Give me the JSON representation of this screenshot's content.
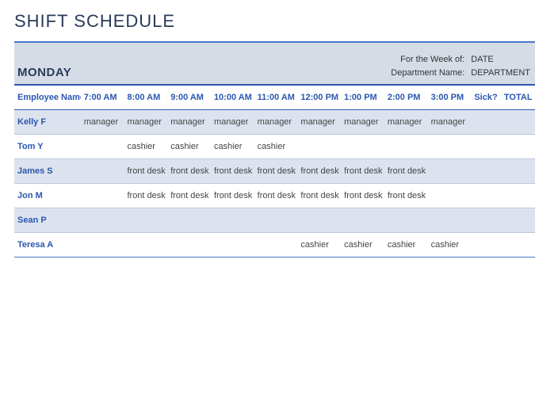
{
  "title": "SHIFT SCHEDULE",
  "day": "MONDAY",
  "meta": {
    "week_label": "For the Week of:",
    "week_value": "DATE",
    "dept_label": "Department Name:",
    "dept_value": "DEPARTMENT"
  },
  "columns": {
    "employee": "Employee Name",
    "t0": "7:00 AM",
    "t1": "8:00 AM",
    "t2": "9:00 AM",
    "t3": "10:00 AM",
    "t4": "11:00 AM",
    "t5": "12:00 PM",
    "t6": "1:00 PM",
    "t7": "2:00 PM",
    "t8": "3:00 PM",
    "sick": "Sick?",
    "total": "TOTAL"
  },
  "rows": [
    {
      "name": "Kelly F",
      "t0": "manager",
      "t1": "manager",
      "t2": "manager",
      "t3": "manager",
      "t4": "manager",
      "t5": "manager",
      "t6": "manager",
      "t7": "manager",
      "t8": "manager"
    },
    {
      "name": "Tom Y",
      "t0": "",
      "t1": "cashier",
      "t2": "cashier",
      "t3": "cashier",
      "t4": "cashier",
      "t5": "",
      "t6": "",
      "t7": "",
      "t8": ""
    },
    {
      "name": "James S",
      "t0": "",
      "t1": "front desk",
      "t2": "front desk",
      "t3": "front desk",
      "t4": "front desk",
      "t5": "front desk",
      "t6": "front desk",
      "t7": "front desk",
      "t8": ""
    },
    {
      "name": "Jon M",
      "t0": "",
      "t1": "front desk",
      "t2": "front desk",
      "t3": "front desk",
      "t4": "front desk",
      "t5": "front desk",
      "t6": "front desk",
      "t7": "front desk",
      "t8": ""
    },
    {
      "name": "Sean P",
      "t0": "",
      "t1": "",
      "t2": "",
      "t3": "",
      "t4": "",
      "t5": "",
      "t6": "",
      "t7": "",
      "t8": ""
    },
    {
      "name": "Teresa A",
      "t0": "",
      "t1": "",
      "t2": "",
      "t3": "",
      "t4": "",
      "t5": "cashier",
      "t6": "cashier",
      "t7": "cashier",
      "t8": "cashier"
    }
  ]
}
